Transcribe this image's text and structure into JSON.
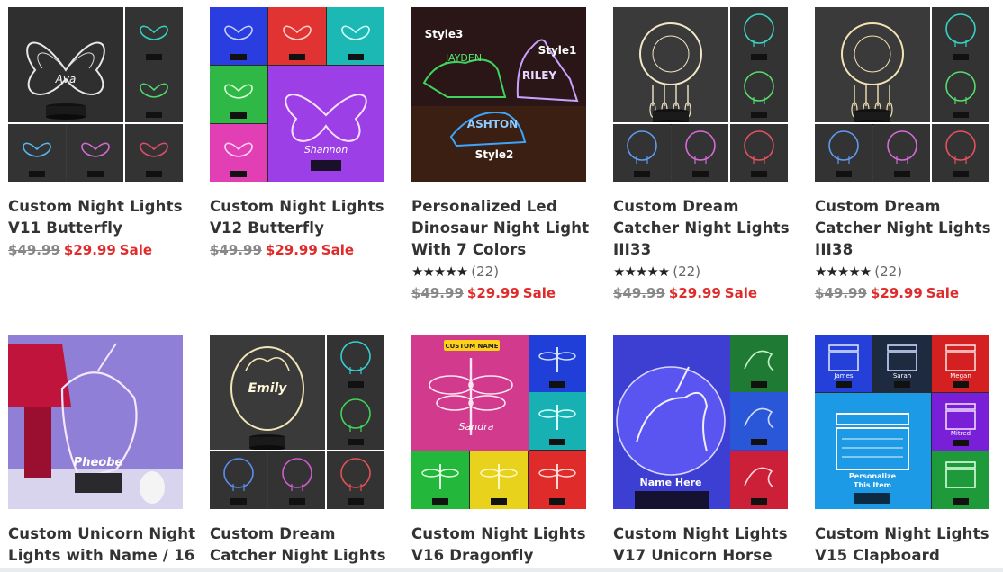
{
  "colors": {
    "title": "#333333",
    "old_price": "#888888",
    "sale": "#e02b2b",
    "stars": "#222222"
  },
  "products": [
    {
      "title_lines": [
        "Custom Night Lights",
        "V11 Butterfly"
      ],
      "rating": null,
      "old_price": "$49.99",
      "price": "$29.99",
      "sale_label": "Sale",
      "thumb_overlay_text": [
        "Ava"
      ],
      "thumb_icon": "butterfly-lamp-image"
    },
    {
      "title_lines": [
        "Custom Night Lights",
        "V12 Butterfly"
      ],
      "rating": null,
      "old_price": "$49.99",
      "price": "$29.99",
      "sale_label": "Sale",
      "thumb_overlay_text": [
        "Shannon"
      ],
      "thumb_icon": "butterfly-lamp-image"
    },
    {
      "title_lines": [
        "Personalized Led",
        "Dinosaur Night Light",
        "With 7 Colors"
      ],
      "rating": {
        "stars": "★★★★★",
        "count": "(22)"
      },
      "old_price": "$49.99",
      "price": "$29.99",
      "sale_label": "Sale",
      "thumb_overlay_text": [
        "Style3",
        "Style1",
        "JAYDEN",
        "RILEY",
        "ASHTON",
        "Style2"
      ],
      "thumb_icon": "dinosaur-lamp-image"
    },
    {
      "title_lines": [
        "Custom Dream",
        "Catcher Night Lights",
        "III33"
      ],
      "rating": {
        "stars": "★★★★★",
        "count": "(22)"
      },
      "old_price": "$49.99",
      "price": "$29.99",
      "sale_label": "Sale",
      "thumb_overlay_text": [],
      "thumb_icon": "dreamcatcher-lamp-image"
    },
    {
      "title_lines": [
        "Custom Dream",
        "Catcher Night Lights",
        "III38"
      ],
      "rating": {
        "stars": "★★★★★",
        "count": "(22)"
      },
      "old_price": "$49.99",
      "price": "$29.99",
      "sale_label": "Sale",
      "thumb_overlay_text": [],
      "thumb_icon": "dreamcatcher-lamp-image"
    },
    {
      "title_lines": [
        "Custom Unicorn Night",
        "Lights with Name / 16"
      ],
      "rating": null,
      "old_price": null,
      "price": null,
      "sale_label": null,
      "thumb_overlay_text": [
        "Pheobe"
      ],
      "thumb_icon": "unicorn-lamp-image"
    },
    {
      "title_lines": [
        "Custom Dream",
        "Catcher Night Lights"
      ],
      "rating": null,
      "old_price": null,
      "price": null,
      "sale_label": null,
      "thumb_overlay_text": [
        "Emily"
      ],
      "thumb_icon": "dreamcatcher-lamp-image"
    },
    {
      "title_lines": [
        "Custom Night Lights",
        "V16 Dragonfly"
      ],
      "rating": null,
      "old_price": null,
      "price": null,
      "sale_label": null,
      "thumb_overlay_text": [
        "CUSTOM NAME",
        "Sandra"
      ],
      "thumb_icon": "dragonfly-lamp-image"
    },
    {
      "title_lines": [
        "Custom Night Lights",
        "V17 Unicorn Horse"
      ],
      "rating": null,
      "old_price": null,
      "price": null,
      "sale_label": null,
      "thumb_overlay_text": [
        "Name Here"
      ],
      "thumb_icon": "unicorn-horse-lamp-image"
    },
    {
      "title_lines": [
        "Custom Night Lights",
        "V15 Clapboard"
      ],
      "rating": null,
      "old_price": null,
      "price": null,
      "sale_label": null,
      "thumb_overlay_text": [
        "James",
        "Sarah",
        "Megan",
        "Mitred",
        "Personalize",
        "This Item"
      ],
      "thumb_icon": "clapboard-lamp-image"
    }
  ]
}
